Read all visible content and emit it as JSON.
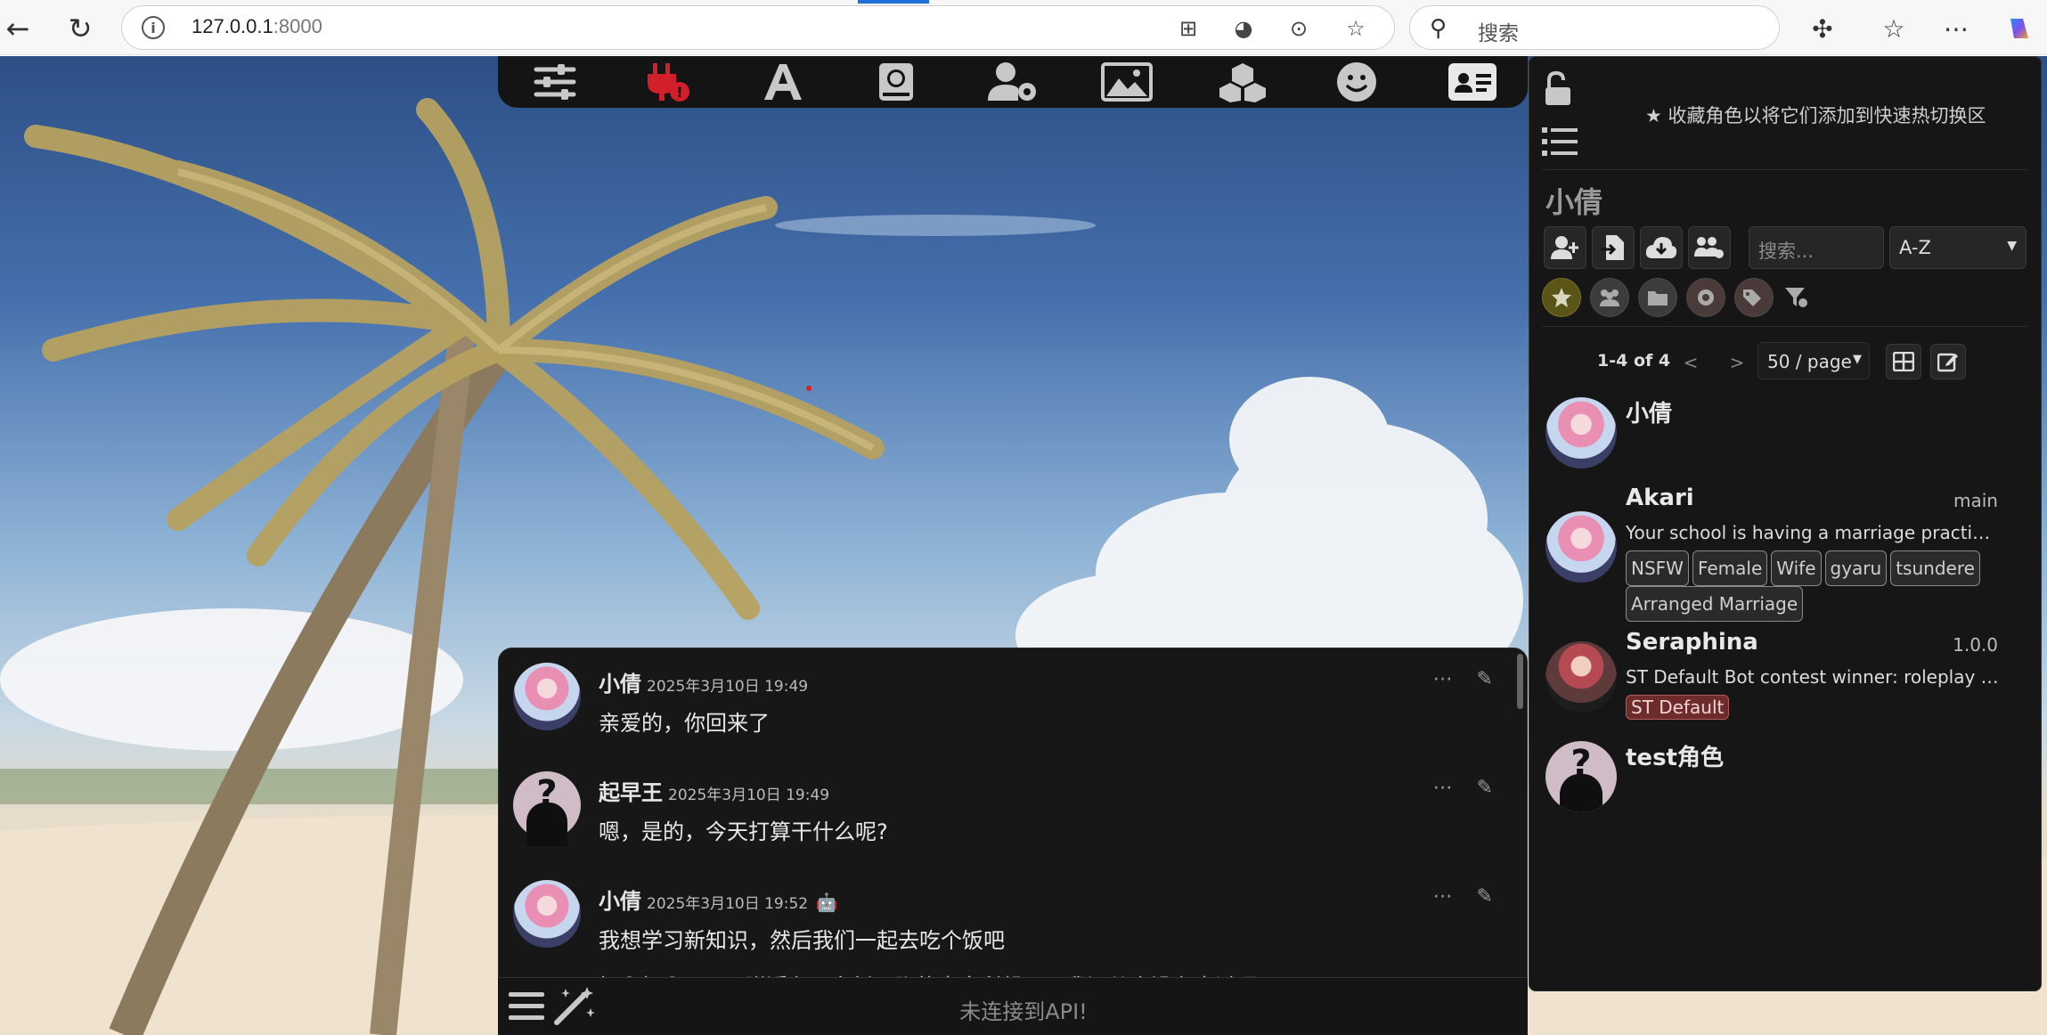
{
  "browser": {
    "url_host": "127.0.0.1",
    "url_port": ":8000",
    "search_placeholder": "搜索"
  },
  "top_toolbar": {
    "tools": [
      "sliders-icon",
      "plug-icon",
      "font-icon",
      "book-icon",
      "user-gear-icon",
      "image-icon",
      "cubes-icon",
      "smile-icon",
      "id-card-icon"
    ],
    "alert_color": "#d21f2a"
  },
  "panel": {
    "hint": "★ 收藏角色以将它们添加到快速热切换区",
    "current_name": "小倩",
    "search_placeholder": "搜索...",
    "sort_value": "A-Z",
    "pagination": {
      "range": "1-4 of 4",
      "prev": "<",
      "next": ">",
      "per_page": "50 / page"
    },
    "characters": [
      {
        "name": "小倩",
        "version": "",
        "description": "",
        "tags": []
      },
      {
        "name": "Akari",
        "version": "main",
        "description": "Your school is having a marriage practical exam...",
        "tags": [
          "NSFW",
          "Female",
          "Wife",
          "gyaru",
          "tsundere",
          "Arranged Marriage"
        ]
      },
      {
        "name": "Seraphina",
        "version": "1.0.0",
        "description": "ST Default Bot contest winner: roleplay bots ...",
        "tags": [
          "ST Default"
        ]
      },
      {
        "name": "test角色",
        "version": "",
        "description": "",
        "tags": []
      }
    ]
  },
  "chat": {
    "messages": [
      {
        "name": "小倩",
        "time": "2025年3月10日 19:49",
        "text": "亲爱的，你回来了"
      },
      {
        "name": "起早王",
        "time": "2025年3月10日 19:49",
        "text": "嗯，是的，今天打算干什么呢?"
      },
      {
        "name": "小倩",
        "time": "2025年3月10日 19:52",
        "text": "我想学习新知识，然后我们一起去吃个饭吧"
      }
    ],
    "partial_text": "好啊好啊，you附近有一家新开张的意大利餐厅，我还从来没有去过呢!",
    "input_placeholder": "未连接到API!"
  }
}
